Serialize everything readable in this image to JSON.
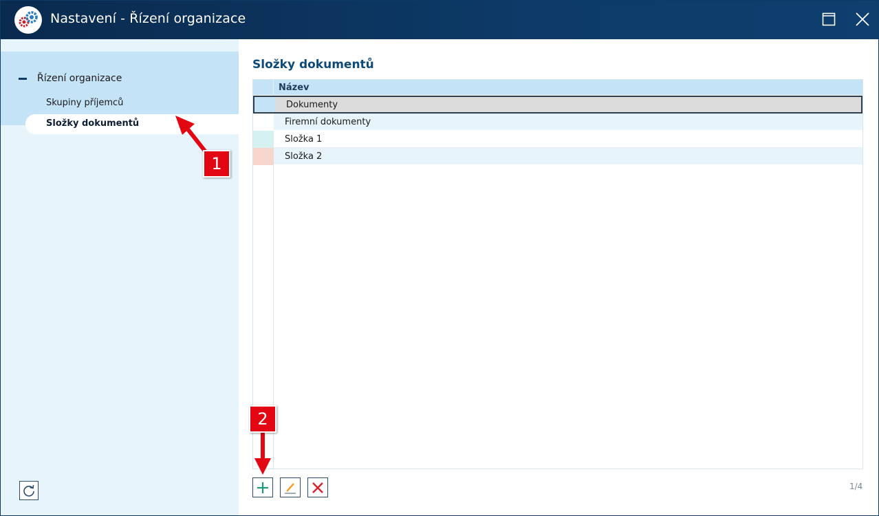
{
  "window": {
    "title": "Nastavení - Řízení organizace",
    "accent": "#0d3a68"
  },
  "sidebar": {
    "root": {
      "label": "Řízení organizace",
      "expanded": true
    },
    "items": [
      {
        "label": "Skupiny příjemců",
        "selected": false
      },
      {
        "label": "Složky dokumentů",
        "selected": true
      }
    ]
  },
  "main": {
    "title": "Složky dokumentů",
    "grid": {
      "column_header": "Název",
      "rows": [
        {
          "name": "Dokumenty",
          "color": "#c5e3f6",
          "selected": true
        },
        {
          "name": "Firemní dokumenty",
          "color": "#ffffff",
          "selected": false
        },
        {
          "name": "Složka 1",
          "color": "#d6f1f2",
          "selected": false
        },
        {
          "name": "Složka 2",
          "color": "#f5d5cc",
          "selected": false
        }
      ]
    },
    "toolbar": {
      "add_icon": "plus-icon",
      "edit_icon": "pencil-icon",
      "delete_icon": "x-icon"
    },
    "pager": "1/4"
  },
  "annotations": {
    "callout_1": "1",
    "callout_2": "2",
    "color": "#e30613"
  }
}
